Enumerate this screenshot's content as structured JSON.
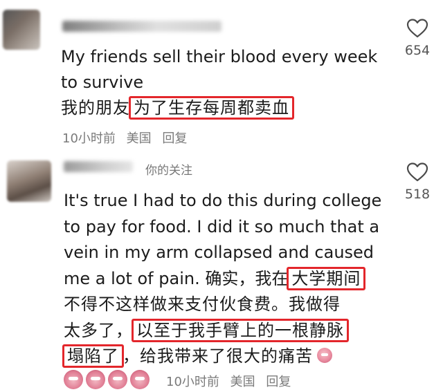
{
  "comments": [
    {
      "like_count": "654",
      "text_lines": [
        "My friends sell their blood every week",
        "to survive"
      ],
      "zh_plain": "我的朋友",
      "zh_highlight": "为了生存每周都卖血",
      "time": "10小时前",
      "location": "美国",
      "reply": "回复"
    },
    {
      "follow_tag": "你的关注",
      "like_count": "518",
      "en_lines": [
        "It's true I had to do this during college",
        "to pay for food. I did it so much that a",
        "vein in my arm collapsed and caused"
      ],
      "line4_plain": "me a lot of pain. 确实，我在",
      "line4_hl": "大学期间",
      "line5": "不得不这样做来支付伙食费。我做得",
      "line6_plain": "太多了，",
      "line6_hl": "以至于我手臂上的一根静脉",
      "line7_hl": "塌陷了",
      "line7_plain": "，给我带来了很大的痛苦",
      "time": "10小时前",
      "location": "美国",
      "reply": "回复"
    }
  ],
  "icons": {
    "like": "heart-outline-icon",
    "emoji": "pink-face-emoji-icon"
  },
  "colors": {
    "highlight": "#e3262b",
    "meta_text": "#7a7a7a"
  }
}
